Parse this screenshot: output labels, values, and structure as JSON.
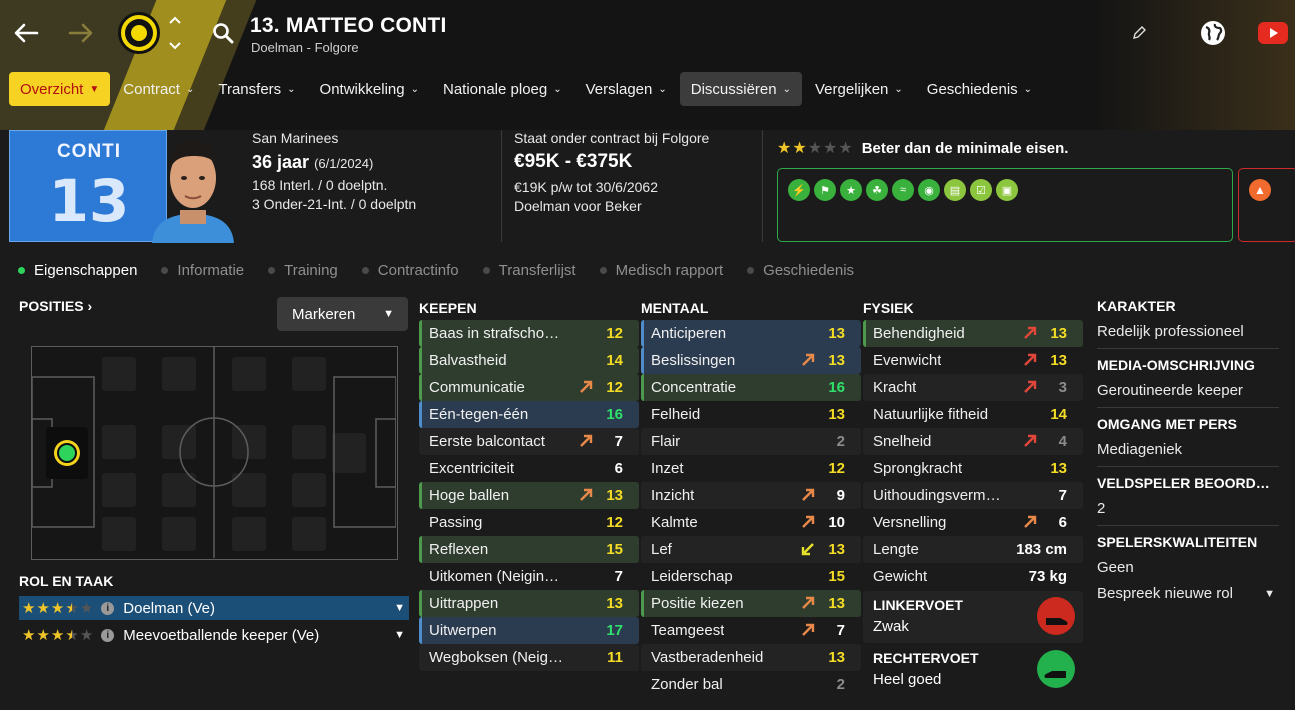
{
  "header": {
    "title": "13. MATTEO CONTI",
    "subtitle": "Doelman - Folgore"
  },
  "nav_tabs": [
    {
      "label": "Overzicht",
      "active": true
    },
    {
      "label": "Contract"
    },
    {
      "label": "Transfers"
    },
    {
      "label": "Ontwikkeling"
    },
    {
      "label": "Nationale ploeg"
    },
    {
      "label": "Verslagen"
    },
    {
      "label": "Discussiëren",
      "highlighted": true
    },
    {
      "label": "Vergelijken"
    },
    {
      "label": "Geschiedenis"
    }
  ],
  "jersey": {
    "name": "CONTI",
    "number": "13",
    "color": "#2c79d6"
  },
  "bio": {
    "nationality": "San Marinees",
    "age": "36 jaar",
    "birthdate": "(6/1/2024)",
    "caps": "168 Interl. / 0 doelptn.",
    "u21_caps": "3 Onder-21-Int. / 0 doelptn"
  },
  "contract": {
    "status": "Staat onder contract bij Folgore",
    "value": "€95K - €375K",
    "wage": "€19K p/w tot 30/6/2062",
    "role": "Doelman voor Beker"
  },
  "rating": {
    "stars": 2,
    "max": 5,
    "text": "Beter dan de minimale eisen."
  },
  "traits": [
    "bolt-icon",
    "flag-icon",
    "star-icon",
    "leaf-icon",
    "wave-icon",
    "brain-icon",
    "clipboard-icon",
    "clipboard-check-icon",
    "pitch-icon"
  ],
  "subtabs": [
    {
      "label": "Eigenschappen",
      "active": true
    },
    {
      "label": "Informatie"
    },
    {
      "label": "Training"
    },
    {
      "label": "Contractinfo"
    },
    {
      "label": "Transferlijst"
    },
    {
      "label": "Medisch rapport"
    },
    {
      "label": "Geschiedenis"
    }
  ],
  "positions": {
    "heading": "POSITIES",
    "mark_label": "Markeren",
    "current": "GK"
  },
  "roles": {
    "heading": "ROL EN TAAK",
    "items": [
      {
        "name": "Doelman (Ve)",
        "stars": 3.5,
        "selected": true
      },
      {
        "name": "Meevoetballende keeper (Ve)",
        "stars": 3.5
      }
    ]
  },
  "keepen": {
    "heading": "KEEPEN",
    "items": [
      {
        "name": "Baas in strafschopgebied",
        "value": "12",
        "color": "yel",
        "hl": "g"
      },
      {
        "name": "Balvastheid",
        "value": "14",
        "color": "yel",
        "hl": "g"
      },
      {
        "name": "Communicatie",
        "value": "12",
        "color": "yel",
        "hl": "g",
        "trend": "up"
      },
      {
        "name": "Eén-tegen-één",
        "value": "16",
        "color": "grn",
        "hl": "b"
      },
      {
        "name": "Eerste balcontact",
        "value": "7",
        "color": "white",
        "trend": "up"
      },
      {
        "name": "Excentriciteit",
        "value": "6",
        "color": "white"
      },
      {
        "name": "Hoge ballen",
        "value": "13",
        "color": "yel",
        "hl": "g",
        "trend": "up"
      },
      {
        "name": "Passing",
        "value": "12",
        "color": "yel"
      },
      {
        "name": "Reflexen",
        "value": "15",
        "color": "yel",
        "hl": "g"
      },
      {
        "name": "Uitkomen (Neigingen)",
        "value": "7",
        "color": "white"
      },
      {
        "name": "Uittrappen",
        "value": "13",
        "color": "yel",
        "hl": "g"
      },
      {
        "name": "Uitwerpen",
        "value": "17",
        "color": "grn",
        "hl": "b"
      },
      {
        "name": "Wegboksen (Neigingen)",
        "value": "11",
        "color": "yel"
      }
    ]
  },
  "mentaal": {
    "heading": "MENTAAL",
    "items": [
      {
        "name": "Anticiperen",
        "value": "13",
        "color": "yel",
        "hl": "b"
      },
      {
        "name": "Beslissingen",
        "value": "13",
        "color": "yel",
        "hl": "b",
        "trend": "up"
      },
      {
        "name": "Concentratie",
        "value": "16",
        "color": "grn",
        "hl": "g"
      },
      {
        "name": "Felheid",
        "value": "13",
        "color": "yel"
      },
      {
        "name": "Flair",
        "value": "2",
        "color": "grey"
      },
      {
        "name": "Inzet",
        "value": "12",
        "color": "yel"
      },
      {
        "name": "Inzicht",
        "value": "9",
        "color": "white",
        "trend": "up"
      },
      {
        "name": "Kalmte",
        "value": "10",
        "color": "white",
        "trend": "up"
      },
      {
        "name": "Lef",
        "value": "13",
        "color": "yel",
        "trend": "down"
      },
      {
        "name": "Leiderschap",
        "value": "15",
        "color": "yel"
      },
      {
        "name": "Positie kiezen",
        "value": "13",
        "color": "yel",
        "hl": "g",
        "trend": "up"
      },
      {
        "name": "Teamgeest",
        "value": "7",
        "color": "white",
        "trend": "up"
      },
      {
        "name": "Vastberadenheid",
        "value": "13",
        "color": "yel"
      },
      {
        "name": "Zonder bal",
        "value": "2",
        "color": "grey"
      }
    ]
  },
  "fysiek": {
    "heading": "FYSIEK",
    "items": [
      {
        "name": "Behendigheid",
        "value": "13",
        "color": "yel",
        "hl": "g",
        "trend": "red"
      },
      {
        "name": "Evenwicht",
        "value": "13",
        "color": "yel",
        "trend": "red"
      },
      {
        "name": "Kracht",
        "value": "3",
        "color": "grey",
        "trend": "red"
      },
      {
        "name": "Natuurlijke fitheid",
        "value": "14",
        "color": "yel"
      },
      {
        "name": "Snelheid",
        "value": "4",
        "color": "grey",
        "trend": "red"
      },
      {
        "name": "Sprongkracht",
        "value": "13",
        "color": "yel"
      },
      {
        "name": "Uithoudingsvermogen",
        "value": "7",
        "color": "white"
      },
      {
        "name": "Versnelling",
        "value": "6",
        "color": "white",
        "trend": "up"
      },
      {
        "name": "Lengte",
        "value": "183 cm",
        "color": "white"
      },
      {
        "name": "Gewicht",
        "value": "73 kg",
        "color": "white"
      }
    ],
    "left_foot": {
      "label": "LINKERVOET",
      "value": "Zwak",
      "color": "#cc2a1f"
    },
    "right_foot": {
      "label": "RECHTERVOET",
      "value": "Heel goed",
      "color": "#22b14c"
    }
  },
  "side": {
    "karakter": {
      "label": "KARAKTER",
      "value": "Redelijk professioneel"
    },
    "media": {
      "label": "MEDIA-OMSCHRIJVING",
      "value": "Geroutineerde keeper"
    },
    "pers": {
      "label": "OMGANG MET PERS",
      "value": "Mediageniek"
    },
    "veld": {
      "label": "VELDSPELER BEOORDELING",
      "value": "2"
    },
    "kwal": {
      "label": "SPELERSKWALITEITEN",
      "value": "Geen",
      "action": "Bespreek nieuwe rol"
    }
  }
}
